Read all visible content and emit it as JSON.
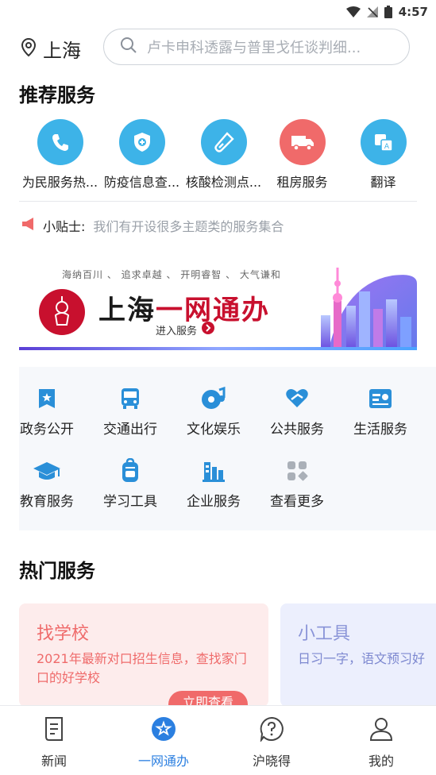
{
  "status_bar": {
    "time": "4:57"
  },
  "header": {
    "location": "上海",
    "search_placeholder": "卢卡申科透露与普里戈任谈判细..."
  },
  "recommended": {
    "title": "推荐服务",
    "items": [
      {
        "label": "为民服务热...",
        "icon": "phone-icon",
        "color": "#3db3e8"
      },
      {
        "label": "防疫信息查...",
        "icon": "shield-plus-icon",
        "color": "#3db3e8"
      },
      {
        "label": "核酸检测点...",
        "icon": "test-tube-icon",
        "color": "#3db3e8"
      },
      {
        "label": "租房服务",
        "icon": "truck-icon",
        "color": "#f06a6a"
      },
      {
        "label": "翻译",
        "icon": "translate-icon",
        "color": "#3db3e8"
      }
    ]
  },
  "tip": {
    "label": "小贴士:",
    "text": "我们有开设很多主题类的服务集合"
  },
  "banner": {
    "slogan": "海纳百川 、 追求卓越 、 开明睿智 、 大气谦和",
    "brand_a": "上海",
    "brand_b": "一网通办",
    "enter": "进入服务"
  },
  "categories": [
    {
      "label": "政务公开",
      "icon": "gov-star-icon"
    },
    {
      "label": "交通出行",
      "icon": "bus-icon"
    },
    {
      "label": "文化娱乐",
      "icon": "music-disc-icon"
    },
    {
      "label": "公共服务",
      "icon": "heart-hand-icon"
    },
    {
      "label": "生活服务",
      "icon": "life-card-icon"
    },
    {
      "label": "教育服务",
      "icon": "graduation-cap-icon"
    },
    {
      "label": "学习工具",
      "icon": "backpack-icon"
    },
    {
      "label": "企业服务",
      "icon": "building-chart-icon"
    },
    {
      "label": "查看更多",
      "icon": "more-grid-icon"
    }
  ],
  "hot": {
    "title": "热门服务",
    "cards": [
      {
        "title": "找学校",
        "desc": "2021年最新对口招生信息，查找家门口的好学校",
        "button": "立即查看"
      },
      {
        "title": "小工具",
        "desc": "日习一字，语文预习好"
      }
    ]
  },
  "tabbar": {
    "items": [
      {
        "label": "新闻",
        "icon": "news-icon"
      },
      {
        "label": "一网通办",
        "icon": "service-star-icon",
        "active": true
      },
      {
        "label": "沪晓得",
        "icon": "question-bubble-icon"
      },
      {
        "label": "我的",
        "icon": "user-icon"
      }
    ]
  }
}
